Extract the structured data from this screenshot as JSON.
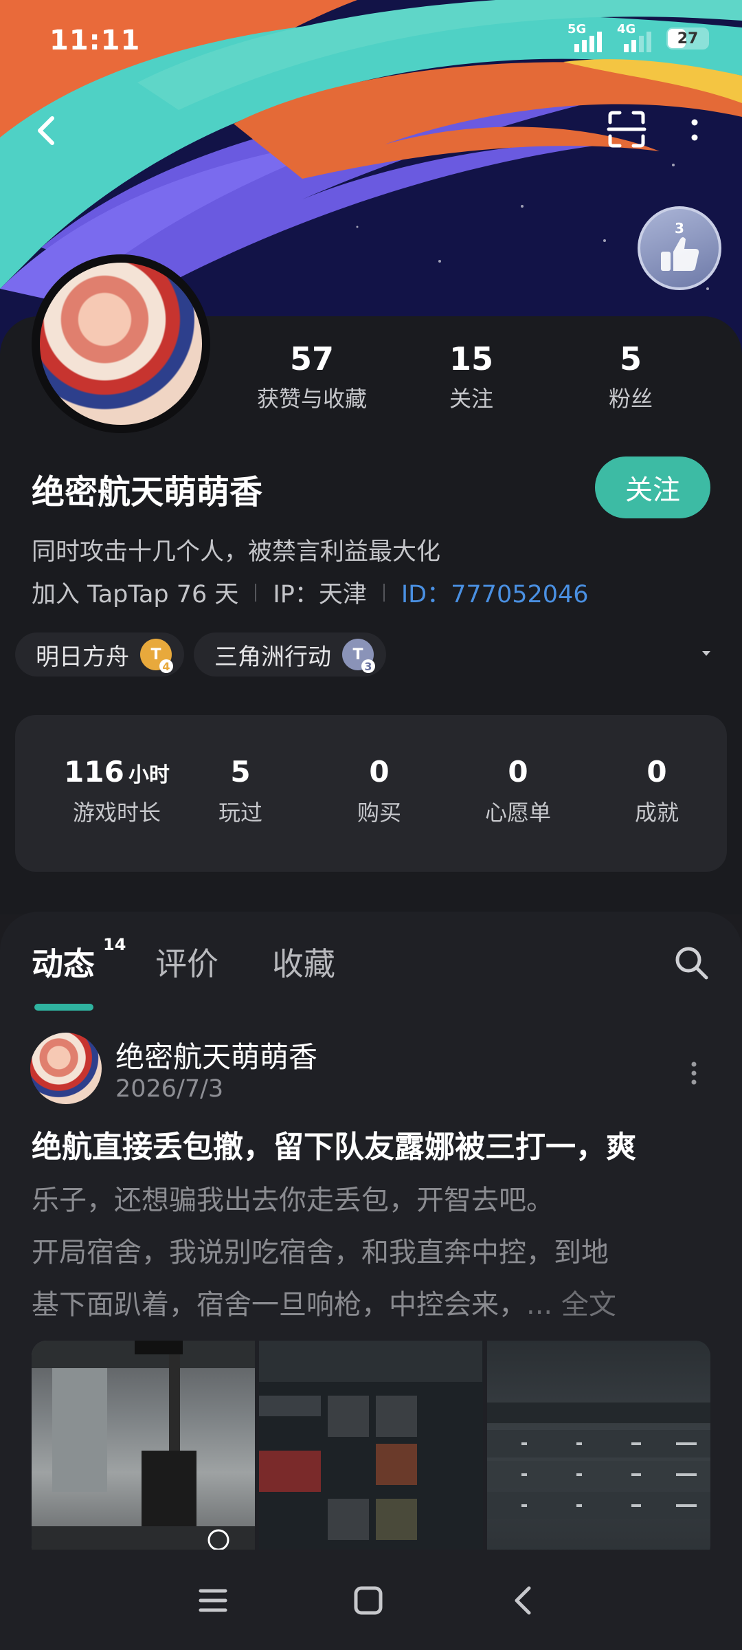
{
  "status_bar": {
    "time": "11:11",
    "net1": "5G",
    "net2": "4G",
    "battery": "27"
  },
  "header": {
    "back_icon": "chevron-left-icon",
    "scan_icon": "scan-icon",
    "more_icon": "more-vertical-icon",
    "medal_level": "3"
  },
  "profile": {
    "stats": [
      {
        "value": "57",
        "label": "获赞与收藏"
      },
      {
        "value": "15",
        "label": "关注"
      },
      {
        "value": "5",
        "label": "粉丝"
      }
    ],
    "name": "绝密航天萌萌香",
    "follow_label": "关注",
    "bio": "同时攻击十几个人，被禁言利益最大化",
    "joined": "加入 TapTap 76 天",
    "ip": "IP：天津",
    "id_label": "ID：",
    "id_value": "777052046",
    "tags": [
      {
        "label": "明日方舟",
        "level": "4",
        "color": "#e8a93c"
      },
      {
        "label": "三角洲行动",
        "level": "3",
        "color": "#8a93b8"
      }
    ]
  },
  "game_stats": [
    {
      "value": "116",
      "unit": "小时",
      "label": "游戏时长"
    },
    {
      "value": "5",
      "label": "玩过"
    },
    {
      "value": "0",
      "label": "购买"
    },
    {
      "value": "0",
      "label": "心愿单"
    },
    {
      "value": "0",
      "label": "成就"
    }
  ],
  "feed": {
    "tabs": [
      {
        "label": "动态",
        "count": "14"
      },
      {
        "label": "评价"
      },
      {
        "label": "收藏"
      }
    ],
    "post": {
      "author": "绝密航天萌萌香",
      "date": "2026/7/3",
      "title": "绝航直接丢包撤，留下队友露娜被三打一，爽",
      "body_lines": [
        "乐子，还想骗我出去你走丢包，开智去吧。",
        "开局宿舍，我说别吃宿舍，和我直奔中控，到地",
        "基下面趴着，宿舍一旦响枪，中控会来，"
      ],
      "ellipsis": "... ",
      "read_more": "全文"
    }
  },
  "colors": {
    "accent": "#3dbba4",
    "id_link": "#4a90e2",
    "background": "#1a1b1f"
  }
}
